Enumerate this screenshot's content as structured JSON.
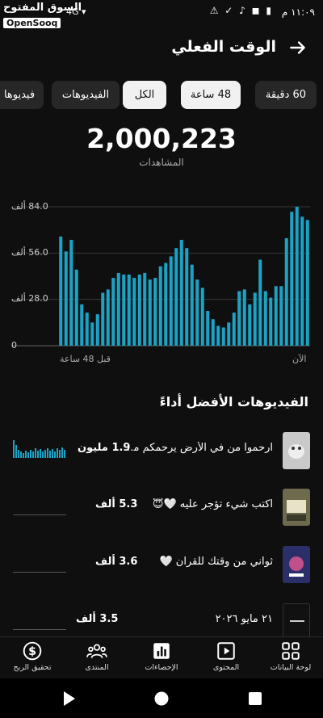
{
  "status_bar": {
    "time": "١١:٠٩ م",
    "icons": "⚠ ✓ ♪ ◼ ▮",
    "signal": "4G ▾"
  },
  "watermark": {
    "arabic": "السوق المفتوح",
    "english": "OpenSooq"
  },
  "header": {
    "title": "الوقت الفعلي",
    "back_icon": "arrow-right-icon"
  },
  "chips": [
    {
      "label": "60 دقيقة",
      "selected": false
    },
    {
      "label": "48 ساعة",
      "selected": true
    },
    {
      "label": "الكل",
      "selected": true
    },
    {
      "label": "الفيديوهات",
      "selected": false
    },
    {
      "label": "فيديوها",
      "selected": false
    }
  ],
  "summary": {
    "value": "2,000,223",
    "label": "المشاهدات"
  },
  "chart_data": {
    "type": "bar",
    "y_tick_labels": [
      "84.0 ألف",
      "56.0 ألف",
      "28.0 ألف",
      "0"
    ],
    "y_ticks": [
      84,
      56,
      28,
      0
    ],
    "ylim": [
      0,
      84
    ],
    "y_unit": "ألف",
    "x_start_label": "قبل 48 ساعة",
    "x_end_label": "الآن",
    "color": "#1ba3c6",
    "values": [
      66,
      57,
      64,
      46,
      25,
      20,
      14,
      19,
      32,
      34,
      41,
      44,
      43,
      43,
      41,
      43,
      44,
      40,
      41,
      48,
      50,
      54,
      59,
      64,
      59,
      49,
      40,
      35,
      21,
      16,
      12,
      11,
      14,
      20,
      33,
      34,
      25,
      32,
      52,
      33,
      29,
      36,
      36,
      65,
      81,
      84,
      78,
      76
    ]
  },
  "top_videos": {
    "title": "الفيديوهات الأفضل أداءً",
    "items": [
      {
        "title": "ارحموا من في الأرض يرحمكم من...",
        "views": "1.9 مليون",
        "thumb": "#c9c9c9"
      },
      {
        "title": "اكتب شيء تؤجر عليه 🤍😇",
        "views": "5.3 ألف",
        "thumb": "#6d6a4e"
      },
      {
        "title": "ثواني من وقتك للقران 🤍",
        "views": "3.6 ألف",
        "thumb": "#2a2f6a"
      },
      {
        "title": "٢١ مايو ٢٠٢٦",
        "views": "3.5 ألف",
        "thumb": "#111111"
      }
    ]
  },
  "bottom_nav": [
    {
      "label": "لوحة البيانات",
      "icon": "dashboard-icon"
    },
    {
      "label": "المحتوى",
      "icon": "content-icon"
    },
    {
      "label": "الإحصاءات",
      "icon": "analytics-icon"
    },
    {
      "label": "المنتدى",
      "icon": "community-icon"
    },
    {
      "label": "تحقيق الربح",
      "icon": "earn-icon"
    }
  ]
}
